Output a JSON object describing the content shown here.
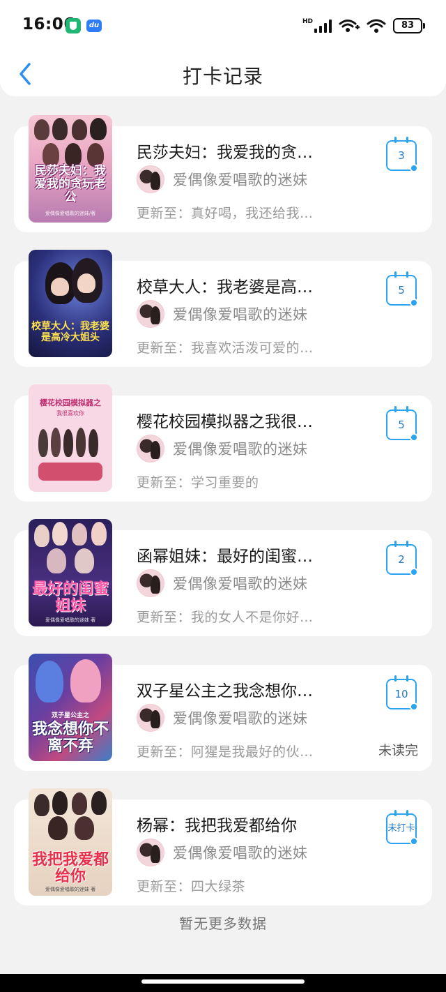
{
  "status_bar": {
    "time": "16:06",
    "network": "HD",
    "battery": "83"
  },
  "nav": {
    "title": "打卡记录"
  },
  "records": [
    {
      "title": "民莎夫妇：我爱我的贪…",
      "cover_text": "民莎夫妇：我爱我的贪玩老公",
      "cover_sub": "爱偶像爱唱歌的迷妹/著",
      "author": "爱偶像爱唱歌的迷妹",
      "update": "更新至：真好喝，我还给我…",
      "checkins": "3",
      "status": ""
    },
    {
      "title": "校草大人：我老婆是高…",
      "cover_text": "校草大人：我老婆是高冷大姐头",
      "cover_sub": "",
      "author": "爱偶像爱唱歌的迷妹",
      "update": "更新至：我喜欢活泼可爱的…",
      "checkins": "5",
      "status": ""
    },
    {
      "title": "樱花校园模拟器之我很…",
      "cover_text": "樱花校园模拟器之",
      "cover_sub": "我很喜欢你",
      "author": "爱偶像爱唱歌的迷妹",
      "update": "更新至：学习重要的",
      "checkins": "5",
      "status": ""
    },
    {
      "title": "函幂姐妹：最好的闺蜜…",
      "cover_text": "最好的闺蜜姐妹",
      "cover_sub": "爱偶像爱唱歌的迷妹 著",
      "author": "爱偶像爱唱歌的迷妹",
      "update": "更新至：我的女人不是你好…",
      "checkins": "2",
      "status": ""
    },
    {
      "title": "双子星公主之我念想你…",
      "cover_text": "我念想你不离不弃",
      "cover_sub": "双子星公主之",
      "author": "爱偶像爱唱歌的迷妹",
      "update": "更新至：阿猩是我最好的伙…",
      "checkins": "10",
      "status": "未读完"
    },
    {
      "title": "杨幂：我把我爱都给你",
      "cover_text": "我把我爱都给你",
      "cover_sub": "爱偶像爱唱歌的迷妹 著",
      "author": "爱偶像爱唱歌的迷妹",
      "update": "更新至：四大绿茶",
      "checkins": "未打卡",
      "status": ""
    }
  ],
  "footer": {
    "text": "暂无更多数据"
  },
  "colors": {
    "accent": "#2aa3f0",
    "background": "#f2f2f2",
    "card": "#ffffff"
  }
}
